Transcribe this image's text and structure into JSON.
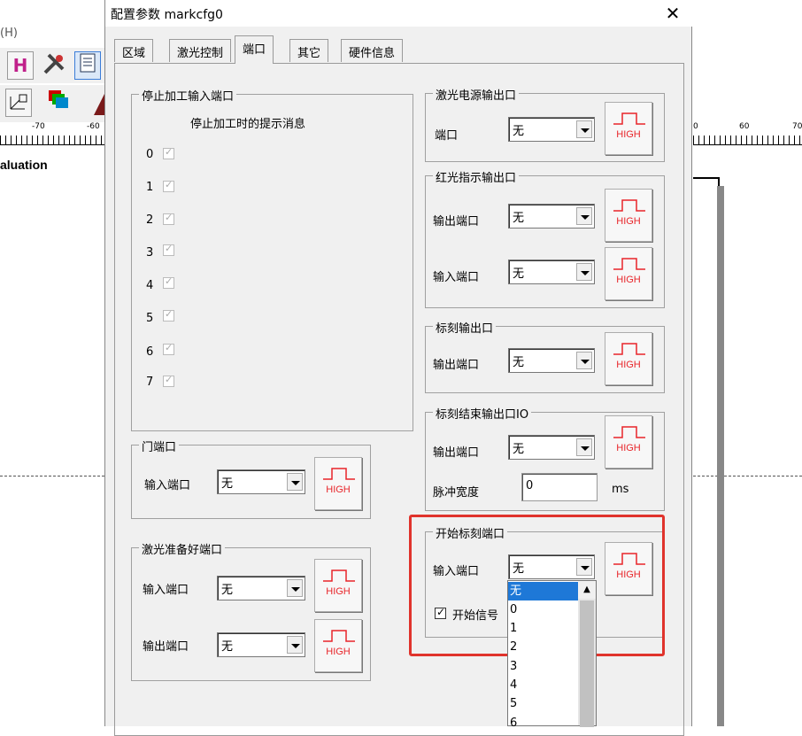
{
  "background_app": {
    "menu_fragment": "(H)",
    "eval_text": "aluation",
    "ruler_left_labels": [
      "-70",
      "-60"
    ],
    "ruler_right_labels": [
      "0",
      "60",
      "70"
    ]
  },
  "dialog": {
    "title": "配置参数 markcfg0",
    "close_glyph": "✕",
    "tabs": [
      {
        "label": "区域",
        "active": false
      },
      {
        "label": "激光控制",
        "active": false
      },
      {
        "label": "端口",
        "active": true
      },
      {
        "label": "其它",
        "active": false
      },
      {
        "label": "硬件信息",
        "active": false
      }
    ]
  },
  "stop_input": {
    "title": "停止加工输入端口",
    "hint_header": "停止加工时的提示消息",
    "ports": [
      "0",
      "1",
      "2",
      "3",
      "4",
      "5",
      "6",
      "7"
    ]
  },
  "door_port": {
    "title": "门端口",
    "input_label": "输入端口",
    "input_value": "无"
  },
  "laser_ready": {
    "title": "激光准备好端口",
    "input_label": "输入端口",
    "input_value": "无",
    "output_label": "输出端口",
    "output_value": "无"
  },
  "laser_power": {
    "title": "激光电源输出口",
    "port_label": "端口",
    "port_value": "无"
  },
  "red_light": {
    "title": "红光指示输出口",
    "output_label": "输出端口",
    "output_value": "无",
    "input_label": "输入端口",
    "input_value": "无"
  },
  "mark_output": {
    "title": "标刻输出口",
    "output_label": "输出端口",
    "output_value": "无"
  },
  "mark_end": {
    "title": "标刻结束输出口IO",
    "output_label": "输出端口",
    "output_value": "无",
    "pulse_label": "脉冲宽度",
    "pulse_value": "0",
    "pulse_unit": "ms"
  },
  "start_mark": {
    "title": "开始标刻端口",
    "input_label": "输入端口",
    "input_value": "无",
    "signal_label": "开始信号",
    "signal_checked": true
  },
  "high_button_text": "HIGH",
  "dropdown": {
    "options": [
      "无",
      "0",
      "1",
      "2",
      "3",
      "4",
      "5",
      "6"
    ],
    "selected": "无"
  },
  "colors": {
    "highlight": "#e0332c",
    "high_text": "#e8252a",
    "selection": "#1e78d7"
  }
}
